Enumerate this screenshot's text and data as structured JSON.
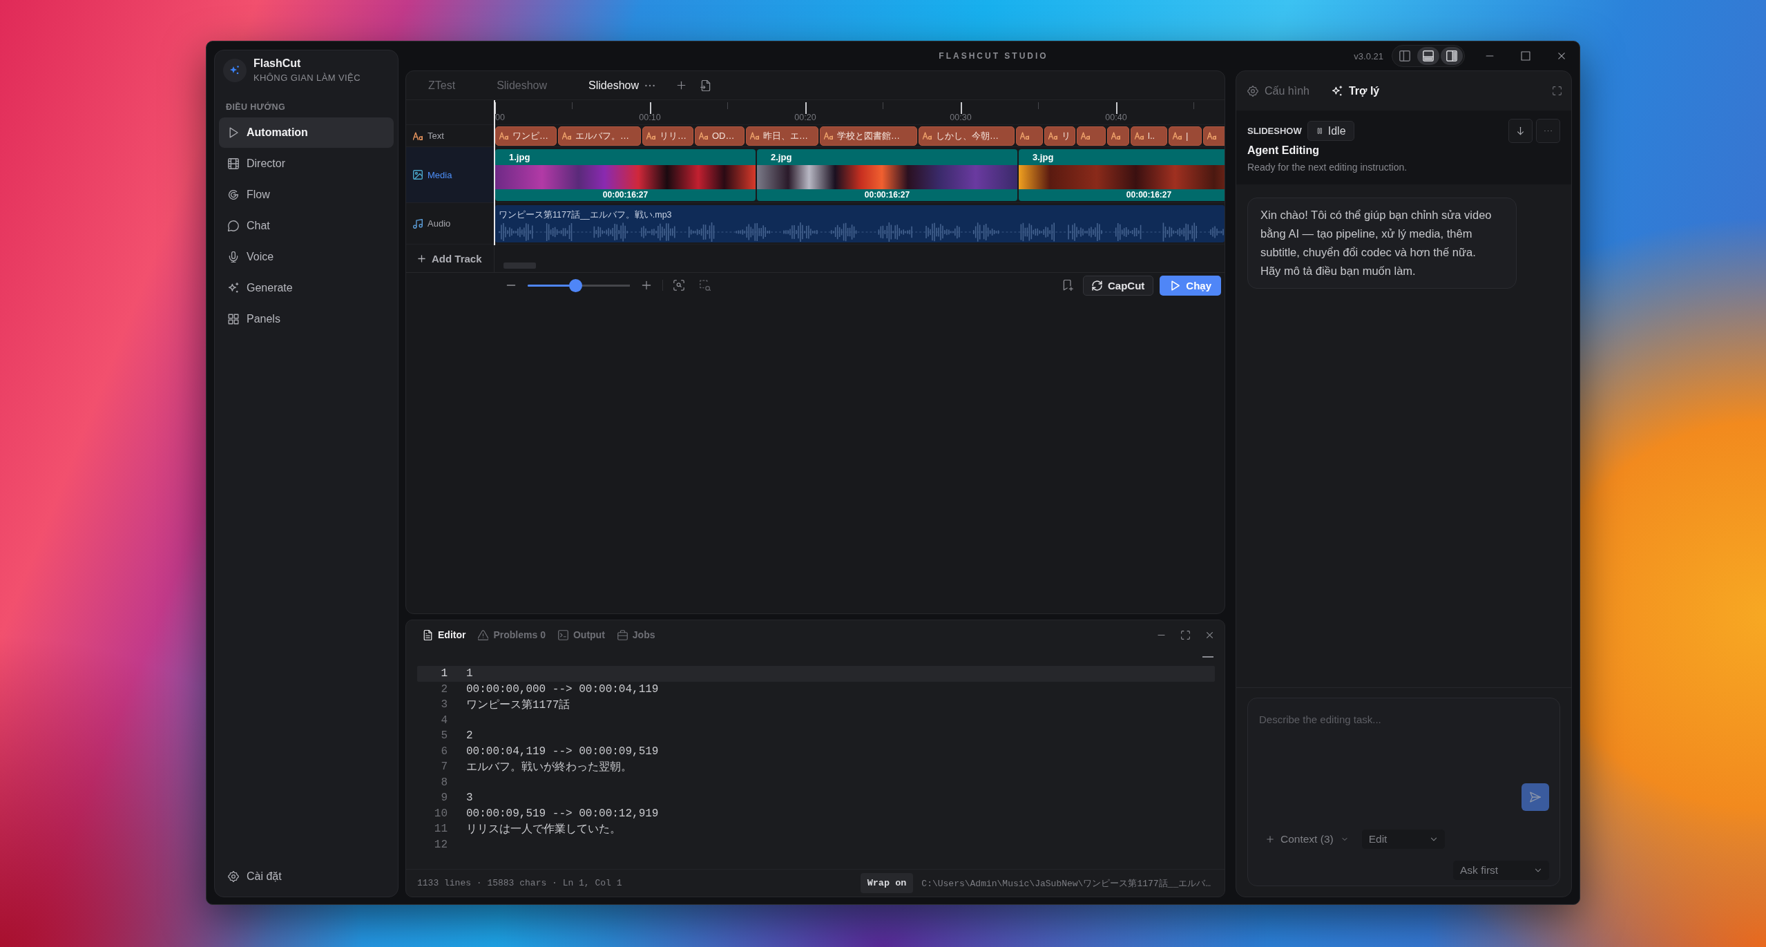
{
  "window": {
    "title": "FLASHCUT STUDIO",
    "version": "v3.0.21",
    "layout_toggles": [
      {
        "on": false
      },
      {
        "on": true
      },
      {
        "on": true
      }
    ]
  },
  "sidebar": {
    "app_name": "FlashCut",
    "workspace_label": "KHÔNG GIAN LÀM VIỆC",
    "section_label": "ĐIỀU HƯỚNG",
    "items": [
      {
        "label": "Automation",
        "selected": true
      },
      {
        "label": "Director",
        "selected": false
      },
      {
        "label": "Flow",
        "selected": false
      },
      {
        "label": "Chat",
        "selected": false
      },
      {
        "label": "Voice",
        "selected": false
      },
      {
        "label": "Generate",
        "selected": false
      },
      {
        "label": "Panels",
        "selected": false
      }
    ],
    "settings": {
      "label": "Cài đặt"
    }
  },
  "tabs": [
    {
      "label": "ZTest",
      "selected": false
    },
    {
      "label": "Slideshow",
      "selected": false
    },
    {
      "label": "Slideshow",
      "selected": true
    }
  ],
  "timeline": {
    "ruler": [
      "00",
      "00:10",
      "00:20",
      "00:30",
      "00:40"
    ],
    "tracks": [
      {
        "kind": "text",
        "name": "Text",
        "selected": false,
        "clips": [
          {
            "kind": "labeled",
            "label": "ワンピ…"
          },
          {
            "kind": "labeled",
            "label": "エルバフ。…"
          },
          {
            "kind": "labeled",
            "label": "リリ…"
          },
          {
            "kind": "labeled",
            "label": "OD…"
          },
          {
            "kind": "labeled",
            "label": "昨日、エ…"
          },
          {
            "kind": "labeled",
            "label": "学校と図書館…"
          },
          {
            "kind": "labeled",
            "label": "しかし、今朝…"
          },
          {
            "kind": "bare"
          },
          {
            "kind": "labeled",
            "label": "リ"
          },
          {
            "kind": "bare"
          },
          {
            "kind": "bare"
          },
          {
            "kind": "labeled",
            "label": "l.."
          },
          {
            "kind": "labeled",
            "label": "|"
          },
          {
            "kind": "bare"
          }
        ]
      },
      {
        "kind": "media",
        "name": "Media",
        "selected": true,
        "clips": [
          {
            "name": "1.jpg",
            "duration": "00:00:16:27"
          },
          {
            "name": "2.jpg",
            "duration": "00:00:16:27"
          },
          {
            "name": "3.jpg",
            "duration": "00:00:16:27"
          }
        ]
      },
      {
        "kind": "audio",
        "name": "Audio",
        "selected": false,
        "clips": [
          {
            "name": "ワンピース第1177話__エルバフ。戦い.mp3"
          }
        ]
      }
    ],
    "add_track": "Add Track",
    "zoom": {
      "level": 0.47
    },
    "export_button": "CapCut",
    "run_button": "Chạy"
  },
  "editor": {
    "tabs": [
      {
        "label": "Editor",
        "selected": true
      },
      {
        "label": "Problems 0",
        "selected": false
      },
      {
        "label": "Output",
        "selected": false
      },
      {
        "label": "Jobs",
        "selected": false
      }
    ],
    "lines": [
      {
        "number": "1",
        "text": "1",
        "current": true
      },
      {
        "number": "2",
        "text": "00:00:00,000 --> 00:00:04,119",
        "current": false
      },
      {
        "number": "3",
        "text": "ワンピース第1177話",
        "current": false
      },
      {
        "number": "4",
        "current": false
      },
      {
        "number": "5",
        "text": "2",
        "current": false
      },
      {
        "number": "6",
        "text": "00:00:04,119 --> 00:00:09,519",
        "current": false
      },
      {
        "number": "7",
        "text": "エルバフ。戦いが終わった翌朝。",
        "current": false
      },
      {
        "number": "8",
        "current": false
      },
      {
        "number": "9",
        "text": "3",
        "current": false
      },
      {
        "number": "10",
        "text": "00:00:09,519 --> 00:00:12,919",
        "current": false
      },
      {
        "number": "11",
        "text": "リリスは一人で作業していた。",
        "current": false
      },
      {
        "number": "12",
        "current": false
      }
    ],
    "status": "1133 lines · 15883 chars · Ln 1, Col 1",
    "wrap_button": "Wrap on",
    "path": "C:\\Users\\Admin\\Music\\JaSubNew\\ワンピース第1177話__エルバ…"
  },
  "assistant": {
    "tabs": [
      {
        "label": "Cấu hình",
        "selected": false
      },
      {
        "label": "Trợ lý",
        "selected": true
      }
    ],
    "project": "SLIDESHOW",
    "status": "Idle",
    "title": "Agent Editing",
    "subtitle": "Ready for the next editing instruction.",
    "messages": [
      {
        "text": "Xin chào! Tôi có thể giúp bạn chỉnh sửa video bằng AI — tạo pipeline, xử lý media, thêm subtitle, chuyển đổi codec và hơn thế nữa. Hãy mô tả điều bạn muốn làm."
      }
    ],
    "input": {
      "placeholder": "Describe the editing task..."
    },
    "context_button": "Context (3)",
    "mode": "Edit",
    "approval": "Ask first"
  }
}
